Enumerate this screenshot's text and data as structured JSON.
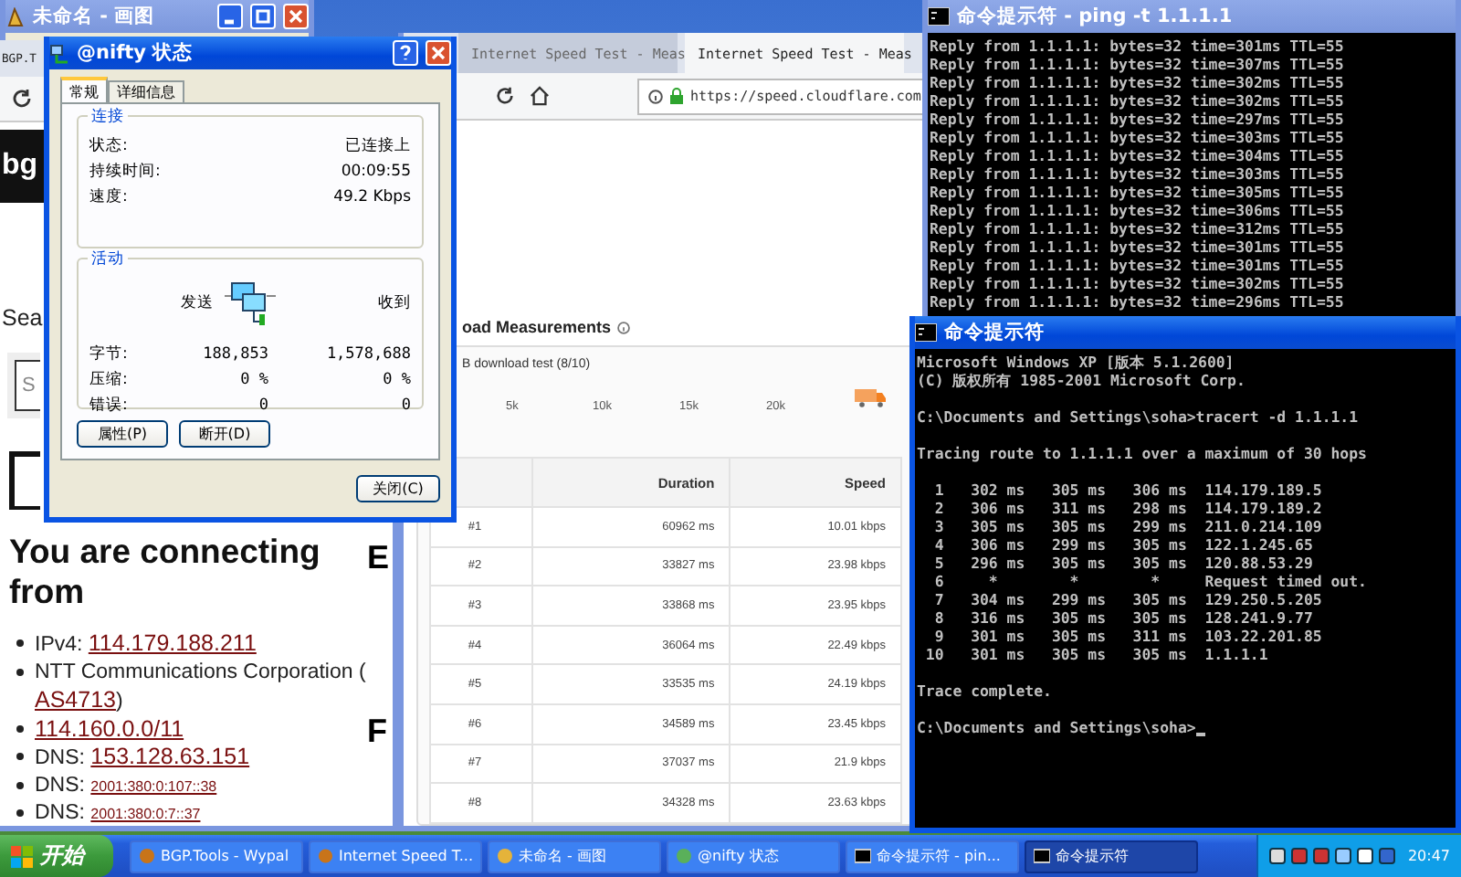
{
  "paint_window": {
    "title": "未命名 - 画图"
  },
  "bgp_browser": {
    "tab": "BGP.T",
    "logo": "bg",
    "search_heading": "Sea",
    "search_placeholder": "S",
    "heading": "You are connecting from",
    "side_headings": [
      "E",
      "F"
    ],
    "facts": [
      {
        "prefix": "IPv4: ",
        "link": "114.179.188.211",
        "small": false
      },
      {
        "prefix": "NTT Communications Corporation (",
        "link": "AS4713",
        "suffix": ")",
        "small": false
      },
      {
        "link": "114.160.0.0/11",
        "small": false
      },
      {
        "prefix": "DNS: ",
        "link": "153.128.63.151",
        "small": false
      },
      {
        "prefix": "DNS: ",
        "link": "2001:380:0:107::38",
        "small": true
      },
      {
        "prefix": "DNS: ",
        "link": "2001:380:0:7::37",
        "small": true
      }
    ]
  },
  "speed_browser": {
    "tabs": [
      {
        "title": "Internet Speed Test - Meas",
        "selected": false
      },
      {
        "title": "Internet Speed Test - Meas",
        "selected": true
      }
    ],
    "url": "https://speed.cloudflare.com",
    "section_title": "oad Measurements",
    "test_title": "B download test (8/10)",
    "axis_labels": [
      "5k",
      "10k",
      "15k",
      "20k"
    ],
    "table": {
      "columns": [
        "Duration",
        "Speed"
      ],
      "rows": [
        {
          "index": "#1",
          "duration": "60962 ms",
          "speed": "10.01 kbps"
        },
        {
          "index": "#2",
          "duration": "33827 ms",
          "speed": "23.98 kbps"
        },
        {
          "index": "#3",
          "duration": "33868 ms",
          "speed": "23.95 kbps"
        },
        {
          "index": "#4",
          "duration": "36064 ms",
          "speed": "22.49 kbps"
        },
        {
          "index": "#5",
          "duration": "33535 ms",
          "speed": "24.19 kbps"
        },
        {
          "index": "#6",
          "duration": "34589 ms",
          "speed": "23.45 kbps"
        },
        {
          "index": "#7",
          "duration": "37037 ms",
          "speed": "21.9 kbps"
        },
        {
          "index": "#8",
          "duration": "34328 ms",
          "speed": "23.63 kbps"
        }
      ]
    }
  },
  "status_dialog": {
    "title": "@nifty 状态",
    "tabs": [
      {
        "label": "常规",
        "selected": true
      },
      {
        "label": "详细信息",
        "selected": false
      }
    ],
    "connection": {
      "title": "连接",
      "rows": [
        {
          "label": "状态:",
          "value": "已连接上"
        },
        {
          "label": "持续时间:",
          "value": "00:09:55"
        },
        {
          "label": "速度:",
          "value": "49.2 Kbps"
        }
      ]
    },
    "activity": {
      "title": "活动",
      "sent_label": "发送",
      "received_label": "收到",
      "rows": [
        {
          "label": "字节:",
          "sent": "188,853",
          "received": "1,578,688"
        },
        {
          "label": "压缩:",
          "sent": "0 %",
          "received": "0 %"
        },
        {
          "label": "错误:",
          "sent": "0",
          "received": "0"
        }
      ]
    },
    "buttons": [
      "属性(P)",
      "断开(D)"
    ],
    "close_button": "关闭(C)"
  },
  "ping_console": {
    "title": "命令提示符 - ping -t 1.1.1.1",
    "lines": [
      "Reply from 1.1.1.1: bytes=32 time=301ms TTL=55",
      "Reply from 1.1.1.1: bytes=32 time=307ms TTL=55",
      "Reply from 1.1.1.1: bytes=32 time=302ms TTL=55",
      "Reply from 1.1.1.1: bytes=32 time=302ms TTL=55",
      "Reply from 1.1.1.1: bytes=32 time=297ms TTL=55",
      "Reply from 1.1.1.1: bytes=32 time=303ms TTL=55",
      "Reply from 1.1.1.1: bytes=32 time=304ms TTL=55",
      "Reply from 1.1.1.1: bytes=32 time=303ms TTL=55",
      "Reply from 1.1.1.1: bytes=32 time=305ms TTL=55",
      "Reply from 1.1.1.1: bytes=32 time=306ms TTL=55",
      "Reply from 1.1.1.1: bytes=32 time=312ms TTL=55",
      "Reply from 1.1.1.1: bytes=32 time=301ms TTL=55",
      "Reply from 1.1.1.1: bytes=32 time=301ms TTL=55",
      "Reply from 1.1.1.1: bytes=32 time=302ms TTL=55",
      "Reply from 1.1.1.1: bytes=32 time=296ms TTL=55"
    ]
  },
  "tracert_console": {
    "title": "命令提示符",
    "blocks": [
      [
        "Microsoft Windows XP [版本 5.1.2600]",
        "(C) 版权所有 1985-2001 Microsoft Corp."
      ],
      [
        "C:\\Documents and Settings\\soha>tracert -d 1.1.1.1"
      ],
      [
        "Tracing route to 1.1.1.1 over a maximum of 30 hops"
      ],
      [
        "  1   302 ms   305 ms   306 ms  114.179.189.5",
        "  2   306 ms   311 ms   298 ms  114.179.189.2",
        "  3   305 ms   305 ms   299 ms  211.0.214.109",
        "  4   306 ms   299 ms   305 ms  122.1.245.65",
        "  5   296 ms   305 ms   305 ms  120.88.53.29",
        "  6     *        *        *     Request timed out.",
        "  7   304 ms   299 ms   305 ms  129.250.5.205",
        "  8   316 ms   305 ms   305 ms  128.241.9.77",
        "  9   301 ms   305 ms   311 ms  103.22.201.85",
        " 10   301 ms   305 ms   305 ms  1.1.1.1"
      ],
      [
        "Trace complete."
      ],
      [
        "C:\\Documents and Settings\\soha>"
      ]
    ]
  },
  "taskbar": {
    "start_label": "开始",
    "items": [
      {
        "label": "BGP.Tools - Wypal",
        "selected": false
      },
      {
        "label": "Internet Speed T...",
        "selected": false
      },
      {
        "label": "未命名 - 画图",
        "selected": false
      },
      {
        "label": "@nifty 状态",
        "selected": false
      },
      {
        "label": "命令提示符 - pin...",
        "selected": false
      },
      {
        "label": "命令提示符",
        "selected": true
      }
    ],
    "clock": "20:47"
  }
}
